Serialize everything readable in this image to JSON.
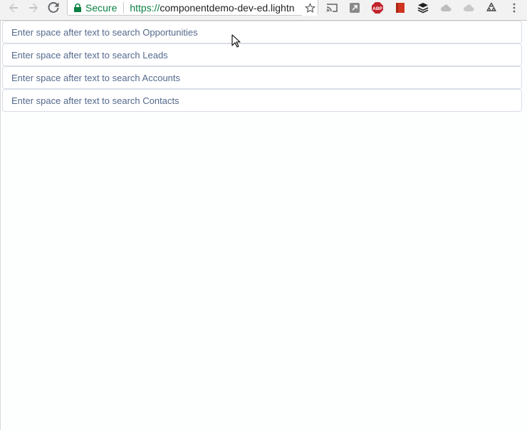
{
  "browser": {
    "secure_label": "Secure",
    "url_scheme": "https://",
    "url_host": "componentdemo-dev-ed.lightn",
    "extensions": [
      "cast-icon",
      "pocket-icon",
      "adblock-plus-icon",
      "bookmark-icon",
      "buffer-icon",
      "cloud-icon",
      "cloud-icon",
      "recycle-icon"
    ],
    "adblock_label": "ABP"
  },
  "search_fields": [
    {
      "placeholder": "Enter space after text to search Opportunities",
      "value": ""
    },
    {
      "placeholder": "Enter space after text to search Leads",
      "value": ""
    },
    {
      "placeholder": "Enter space after text to search Accounts",
      "value": ""
    },
    {
      "placeholder": "Enter space after text to search Contacts",
      "value": ""
    }
  ],
  "colors": {
    "secure_green": "#0b8043",
    "field_border": "#d8dde6",
    "placeholder": "#54698d"
  }
}
